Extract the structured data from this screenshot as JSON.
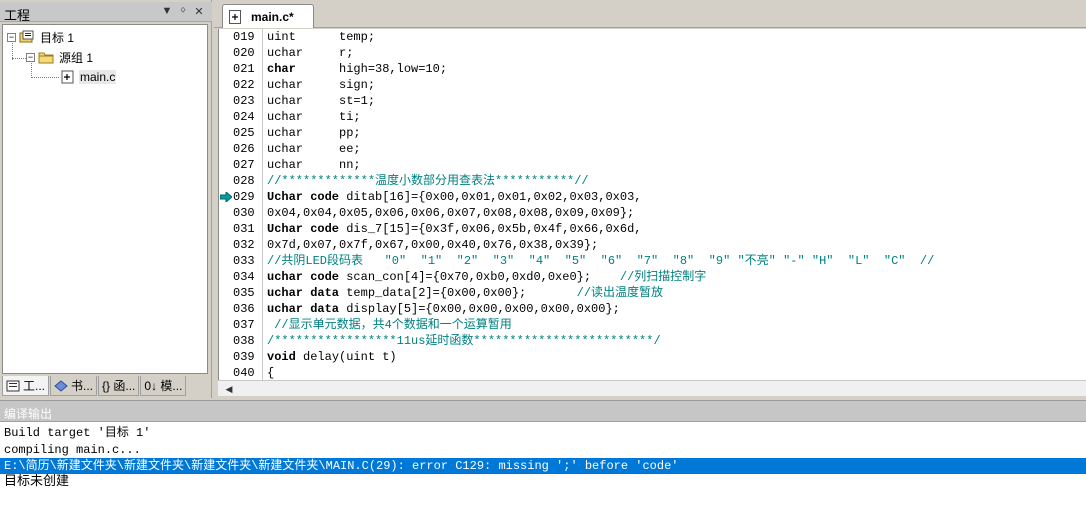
{
  "project_panel": {
    "title": "工程",
    "controls": {
      "dropdown": "▼",
      "pin": "ᛜ",
      "close": "✕"
    },
    "tree": {
      "target": "目标 1",
      "group": "源组 1",
      "file": "main.c"
    },
    "tabs": [
      "工...",
      "书...",
      "{} 函...",
      "0↓ 模..."
    ]
  },
  "editor": {
    "tab_label": "main.c*",
    "lines": [
      {
        "num": "019",
        "text": "uint      temp;"
      },
      {
        "num": "020",
        "text": "uchar     r;"
      },
      {
        "num": "021",
        "text": "char      high=38,low=10;"
      },
      {
        "num": "022",
        "text": "uchar     sign;"
      },
      {
        "num": "023",
        "text": "uchar     st=1;"
      },
      {
        "num": "024",
        "text": "uchar     ti;"
      },
      {
        "num": "025",
        "text": "uchar     pp;"
      },
      {
        "num": "026",
        "text": "uchar     ee;"
      },
      {
        "num": "027",
        "text": "uchar     nn;"
      },
      {
        "num": "028",
        "text": "//*************温度小数部分用查表法***********//"
      },
      {
        "num": "029",
        "text": "Uchar code ditab[16]={0x00,0x01,0x01,0x02,0x03,0x03,"
      },
      {
        "num": "030",
        "text": "0x04,0x04,0x05,0x06,0x06,0x07,0x08,0x08,0x09,0x09};"
      },
      {
        "num": "031",
        "text": "Uchar code dis_7[15]={0x3f,0x06,0x5b,0x4f,0x66,0x6d,"
      },
      {
        "num": "032",
        "text": "0x7d,0x07,0x7f,0x67,0x00,0x40,0x76,0x38,0x39};"
      },
      {
        "num": "033",
        "text": "//共阴LED段码表   \"0\"  \"1\"  \"2\"  \"3\"  \"4\"  \"5\"  \"6\"  \"7\"  \"8\"  \"9\" \"不亮\" \"-\" \"H\"  \"L\"  \"C\"  //"
      },
      {
        "num": "034",
        "text": "uchar code scan_con[4]={0x70,0xb0,0xd0,0xe0};    //列扫描控制字"
      },
      {
        "num": "035",
        "text": "uchar data temp_data[2]={0x00,0x00};       //读出温度暂放"
      },
      {
        "num": "036",
        "text": "uchar data display[5]={0x00,0x00,0x00,0x00,0x00};"
      },
      {
        "num": "037",
        "text": " //显示单元数据，共4个数据和一个运算暂用"
      },
      {
        "num": "038",
        "text": "/*****************11us延时函数*************************/"
      },
      {
        "num": "039",
        "text": "void delay(uint t)"
      },
      {
        "num": "040",
        "text": "{"
      }
    ],
    "current_line": "029"
  },
  "build_output": {
    "title": "编译输出",
    "lines": [
      "Build target '目标 1'",
      "compiling main.c...",
      "E:\\简历\\新建文件夹\\新建文件夹\\新建文件夹\\新建文件夹\\MAIN.C(29): error C129: missing ';' before 'code'",
      "目标未创建"
    ]
  },
  "colors": {
    "comment": "#008080",
    "selection": "#0078d7",
    "arrow": "#00a0a0"
  }
}
